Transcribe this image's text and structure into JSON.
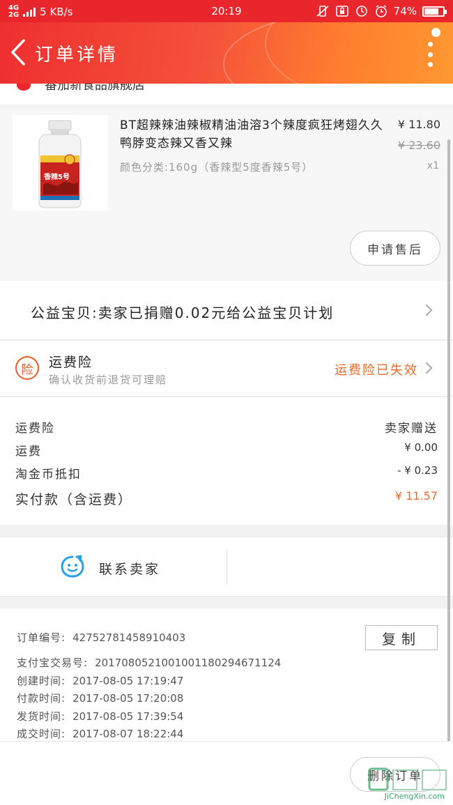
{
  "status_bar": {
    "network_top": "4G",
    "network_bottom": "2G",
    "speed": "5 KB/s",
    "time": "20:19",
    "battery": "74%",
    "battery_level": 0.74
  },
  "header": {
    "title": "订单详情"
  },
  "shop": {
    "name": "番茄新食品旗舰店"
  },
  "product": {
    "title": "BT超辣辣油辣椒精油油溶3个辣度疯狂烤翅久久鸭脖变态辣又香又辣",
    "sku": "颜色分类:160g（香辣型5度香辣5号）",
    "price": "¥ 11.80",
    "original_price": "¥ 23.60",
    "quantity": "x1",
    "aftersale_label": "申请售后",
    "bottle_label": "香辣5号"
  },
  "charity": {
    "text": "公益宝贝:卖家已捐赠0.02元给公益宝贝计划"
  },
  "insurance": {
    "icon_char": "险",
    "title": "运费险",
    "subtitle": "确认收货前退货可理赔",
    "status": "运费险已失效"
  },
  "summary": {
    "rows": [
      {
        "label": "运费险",
        "value": "卖家赠送"
      },
      {
        "label": "运费",
        "value": "¥ 0.00"
      },
      {
        "label": "淘金币抵扣",
        "value": "- ¥ 0.23"
      }
    ],
    "total_label": "实付款（含运费）",
    "total_value": "¥ 11.57"
  },
  "contact": {
    "label": "联系卖家"
  },
  "order_info": {
    "copy_label": "复制",
    "rows": [
      {
        "label": "订单编号:",
        "value": "42752781458910403"
      },
      {
        "label": "支付宝交易号:",
        "value": "2017080521001001180294671124"
      },
      {
        "label": "创建时间:",
        "value": "2017-08-05 17:19:47"
      },
      {
        "label": "付款时间:",
        "value": "2017-08-05 17:20:08"
      },
      {
        "label": "发货时间:",
        "value": "2017-08-05 17:39:54"
      },
      {
        "label": "成交时间:",
        "value": "2017-08-07 18:22:44"
      }
    ]
  },
  "bottom": {
    "delete_label": "删除订单"
  },
  "watermark": {
    "text": "JiChengXin.com"
  },
  "colors": {
    "header_start": "#ee2f2f",
    "header_end": "#ff9830",
    "accent_orange": "#ee6a24"
  }
}
